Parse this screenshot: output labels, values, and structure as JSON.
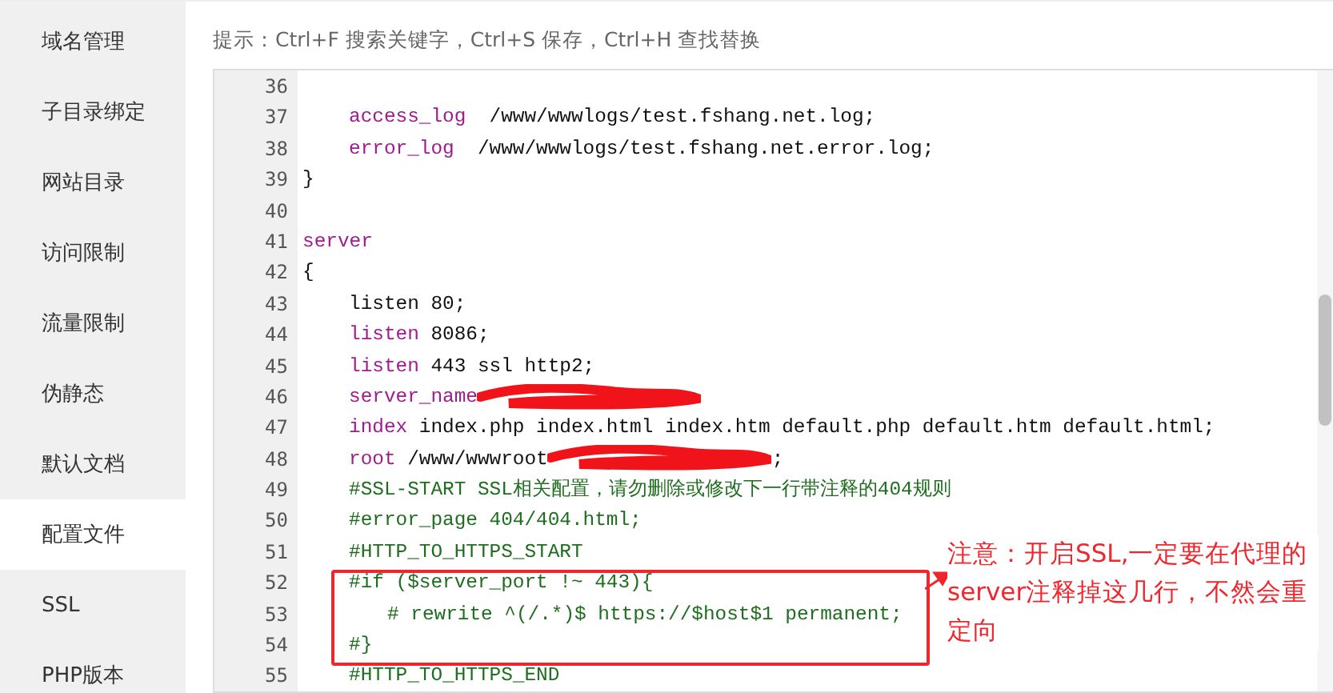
{
  "sidebar": {
    "items": [
      {
        "label": "域名管理",
        "selected": false
      },
      {
        "label": "子目录绑定",
        "selected": false
      },
      {
        "label": "网站目录",
        "selected": false
      },
      {
        "label": "访问限制",
        "selected": false
      },
      {
        "label": "流量限制",
        "selected": false
      },
      {
        "label": "伪静态",
        "selected": false
      },
      {
        "label": "默认文档",
        "selected": false
      },
      {
        "label": "配置文件",
        "selected": true
      },
      {
        "label": "SSL",
        "selected": false
      },
      {
        "label": "PHP版本",
        "selected": false
      }
    ]
  },
  "hint": "提示：Ctrl+F 搜索关键字，Ctrl+S 保存，Ctrl+H 查找替换",
  "editor": {
    "lines": [
      {
        "number": "36"
      },
      {
        "number": "37",
        "kind": "indented",
        "tokens": [
          {
            "kind": "keyword",
            "text": "access_log"
          },
          {
            "kind": "plain",
            "text": "  /www/wwwlogs/test.fshang.net.log;"
          }
        ]
      },
      {
        "number": "38",
        "kind": "indented",
        "tokens": [
          {
            "kind": "keyword",
            "text": "error_log"
          },
          {
            "kind": "plain",
            "text": "  /www/wwwlogs/test.fshang.net.error.log;"
          }
        ]
      },
      {
        "number": "39",
        "kind": "top",
        "tokens": [
          {
            "kind": "plain",
            "text": "}"
          }
        ]
      },
      {
        "number": "40"
      },
      {
        "number": "41",
        "kind": "top",
        "tokens": [
          {
            "kind": "keyword",
            "text": "server"
          }
        ]
      },
      {
        "number": "42",
        "kind": "top",
        "tokens": [
          {
            "kind": "plain",
            "text": "{"
          }
        ]
      },
      {
        "number": "43",
        "kind": "indented",
        "tokens": [
          {
            "kind": "plain",
            "text": "listen 80;"
          }
        ]
      },
      {
        "number": "44",
        "kind": "indented",
        "tokens": [
          {
            "kind": "keyword",
            "text": "listen"
          },
          {
            "kind": "plain",
            "text": " 8086;"
          }
        ]
      },
      {
        "number": "45",
        "kind": "indented",
        "tokens": [
          {
            "kind": "keyword",
            "text": "listen"
          },
          {
            "kind": "plain",
            "text": " 443 ssl http2;"
          }
        ]
      },
      {
        "number": "46",
        "kind": "indented",
        "tokens": [
          {
            "kind": "keyword",
            "text": "server_name"
          },
          {
            "kind": "redacted"
          }
        ]
      },
      {
        "number": "47",
        "kind": "indented",
        "tokens": [
          {
            "kind": "keyword",
            "text": "index"
          },
          {
            "kind": "plain",
            "text": " index.php index.html index.htm default.php default.htm default.html;"
          }
        ]
      },
      {
        "number": "48",
        "kind": "indented",
        "tokens": [
          {
            "kind": "keyword",
            "text": "root"
          },
          {
            "kind": "plain",
            "text": " /www/wwwroot"
          },
          {
            "kind": "redacted"
          },
          {
            "kind": "plain",
            "text": ";"
          }
        ]
      },
      {
        "number": "49",
        "kind": "indented",
        "tokens": [
          {
            "kind": "comment",
            "text": "#SSL-START SSL相关配置，请勿删除或修改下一行带注释的404规则"
          }
        ]
      },
      {
        "number": "50",
        "kind": "indented",
        "tokens": [
          {
            "kind": "comment",
            "text": "#error_page 404/404.html;"
          }
        ]
      },
      {
        "number": "51",
        "kind": "indented",
        "tokens": [
          {
            "kind": "comment",
            "text": "#HTTP_TO_HTTPS_START"
          }
        ]
      },
      {
        "number": "52",
        "kind": "indented",
        "tokens": [
          {
            "kind": "comment",
            "text": "#if ($server_port !~ 443){"
          }
        ]
      },
      {
        "number": "53",
        "kind": "nested",
        "tokens": [
          {
            "kind": "comment",
            "text": "# rewrite ^(/.*)$ https://$host$1 permanent;"
          }
        ]
      },
      {
        "number": "54",
        "kind": "indented",
        "tokens": [
          {
            "kind": "comment",
            "text": "#}"
          }
        ]
      },
      {
        "number": "55",
        "kind": "indented",
        "tokens": [
          {
            "kind": "comment",
            "text": "#HTTP_TO_HTTPS_END"
          }
        ]
      }
    ]
  },
  "annotation": {
    "text": "注意：开启SSL,一定要在代理的server注释掉这几行，不然会重定向"
  }
}
